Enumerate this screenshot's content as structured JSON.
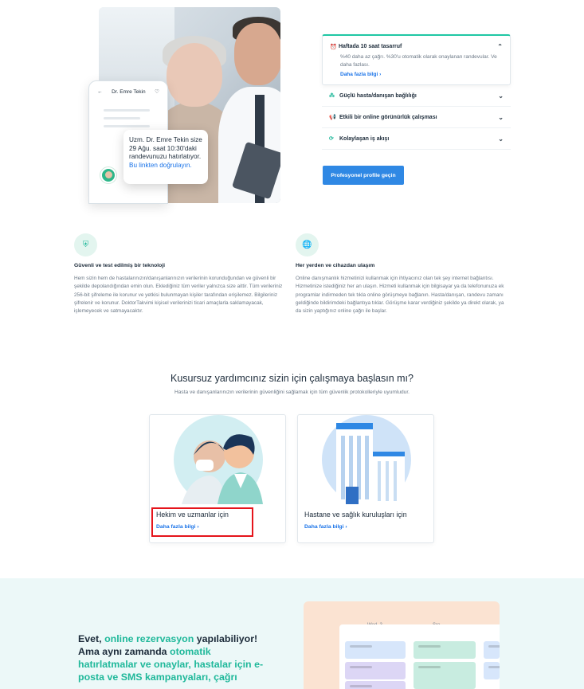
{
  "hero": {
    "phone_name": "Dr. Emre Tekin",
    "reminder_text": "Uzm. Dr. Emre Tekin size 29 Ağu. saat 10:30'daki randevunuzu hatırlatıyor.",
    "reminder_link": "Bu linkten doğrulayın."
  },
  "accordion": {
    "open_item": {
      "title": "Haftada 10 saat tasarruf",
      "body": "%40 daha az çağrı. %30'u otomatik olarak onaylanan randevular. Ve daha fazlası.",
      "link": "Daha fazla bilgi",
      "icon": "alarm-clock-icon"
    },
    "items": [
      {
        "title": "Güçlü hasta/danışan bağlılığı",
        "icon": "people-icon"
      },
      {
        "title": "Etkili bir online görünürlük çalışması",
        "icon": "megaphone-icon"
      },
      {
        "title": "Kolaylaşan iş akışı",
        "icon": "refresh-icon"
      }
    ],
    "button": "Profesyonel profile geçin"
  },
  "features": [
    {
      "icon": "shield-icon",
      "title": "Güvenli ve test edilmiş bir teknoloji",
      "text": "Hem sizin hem de hastalarınızın/danışanlarınızın verilerinin korunduğundan ve güvenli bir şekilde depolandığından emin olun. Eklediğiniz tüm veriler yalnızca size aittir. Tüm verileriniz 256-bit şifreleme ile korunur ve yetkisi bulunmayan kişiler tarafından erişilemez. Bilgileriniz şifrelenir ve korunur. DoktorTakvimi kişisel verilerinizi ticari amaçlarla saklamayacak, işlemeyecek ve satmayacaktır."
    },
    {
      "icon": "globe-icon",
      "title": "Her yerden ve cihazdan ulaşım",
      "text": "Online danışmanlık hizmetinizi kullanmak için ihtiyacınız olan tek şey internet bağlantısı. Hizmetinize istediğiniz her an ulaşın. Hizmeti kullanmak için bilgisayar ya da telefonunuza ek programlar indirmeden tek tıkla online görüşmeye bağlanın. Hasta/danışan, randevu zamanı geldiğinde bildirimdeki bağlantıya tıklar. Görüşme karar verdiğiniz şekilde ya direkt olarak, ya da sizin yaptığınız online çağrı ile başlar."
    }
  ],
  "cta": {
    "title": "Kusursuz yardımcınız sizin için çalışmaya başlasın mı?",
    "subtitle": "Hasta ve danışanlarınızın verilerinin güvenliğini sağlamak için tüm güvenlik protokolleriyle uyumludur.",
    "cards": [
      {
        "title": "Hekim ve uzmanlar için",
        "link": "Daha fazla bilgi"
      },
      {
        "title": "Hastane ve sağlık kuruluşları için",
        "link": "Daha fazla bilgi"
      }
    ]
  },
  "bottom": {
    "part1": "Evet, ",
    "hl1": "online rezervasyon",
    "part2": " yapılabiliyor! Ama aynı zamanda ",
    "hl2": "otomatik hatırlatmalar ve onaylar, hastalar için e-posta ve SMS kampanyaları, çağrı",
    "part3": "",
    "cal_day1": "Wed. 3",
    "cal_day2": "Sro."
  },
  "colors": {
    "accent_teal": "#1fb89a",
    "link_blue": "#1a73e8",
    "button_blue": "#2f88e4",
    "highlight_red": "#e5141b",
    "bottom_bg": "#ecf8f8"
  }
}
